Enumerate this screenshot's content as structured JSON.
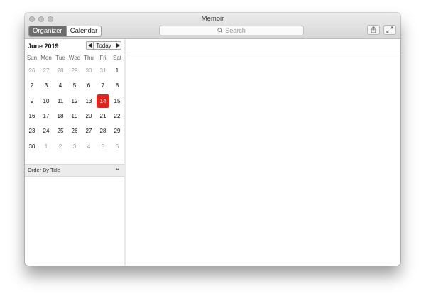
{
  "window": {
    "title": "Memoir",
    "colors": {
      "titlebar": "#dcdcdc",
      "selected_day": "#e8211b",
      "segment_active": "#6d6d6d"
    }
  },
  "toolbar": {
    "tabs": [
      {
        "label": "Organizer",
        "active": true
      },
      {
        "label": "Calendar",
        "active": false
      }
    ],
    "search": {
      "placeholder": "Search",
      "icon": "search-icon"
    },
    "share_icon": "share-icon",
    "fullscreen_icon": "fullscreen-icon"
  },
  "calendar": {
    "month_title": "June 2019",
    "prev_icon": "triangle-left-icon",
    "today_label": "Today",
    "next_icon": "triangle-right-icon",
    "weekdays": [
      "Sun",
      "Mon",
      "Tue",
      "Wed",
      "Thu",
      "Fri",
      "Sat"
    ],
    "weeks": [
      [
        {
          "d": "26",
          "m": true
        },
        {
          "d": "27",
          "m": true
        },
        {
          "d": "28",
          "m": true
        },
        {
          "d": "29",
          "m": true
        },
        {
          "d": "30",
          "m": true
        },
        {
          "d": "31",
          "m": true
        },
        {
          "d": "1"
        }
      ],
      [
        {
          "d": "2"
        },
        {
          "d": "3"
        },
        {
          "d": "4"
        },
        {
          "d": "5"
        },
        {
          "d": "6"
        },
        {
          "d": "7"
        },
        {
          "d": "8"
        }
      ],
      [
        {
          "d": "9"
        },
        {
          "d": "10"
        },
        {
          "d": "11"
        },
        {
          "d": "12"
        },
        {
          "d": "13"
        },
        {
          "d": "14",
          "sel": true
        },
        {
          "d": "15"
        }
      ],
      [
        {
          "d": "16"
        },
        {
          "d": "17"
        },
        {
          "d": "18"
        },
        {
          "d": "19"
        },
        {
          "d": "20"
        },
        {
          "d": "21"
        },
        {
          "d": "22"
        }
      ],
      [
        {
          "d": "23"
        },
        {
          "d": "24"
        },
        {
          "d": "25"
        },
        {
          "d": "26"
        },
        {
          "d": "27"
        },
        {
          "d": "28"
        },
        {
          "d": "29"
        }
      ],
      [
        {
          "d": "30"
        },
        {
          "d": "1",
          "m": true
        },
        {
          "d": "2",
          "m": true
        },
        {
          "d": "3",
          "m": true
        },
        {
          "d": "4",
          "m": true
        },
        {
          "d": "5",
          "m": true
        },
        {
          "d": "6",
          "m": true
        }
      ]
    ]
  },
  "sidebar": {
    "order_label": "Order By Title",
    "order_icon": "chevron-down-icon"
  }
}
